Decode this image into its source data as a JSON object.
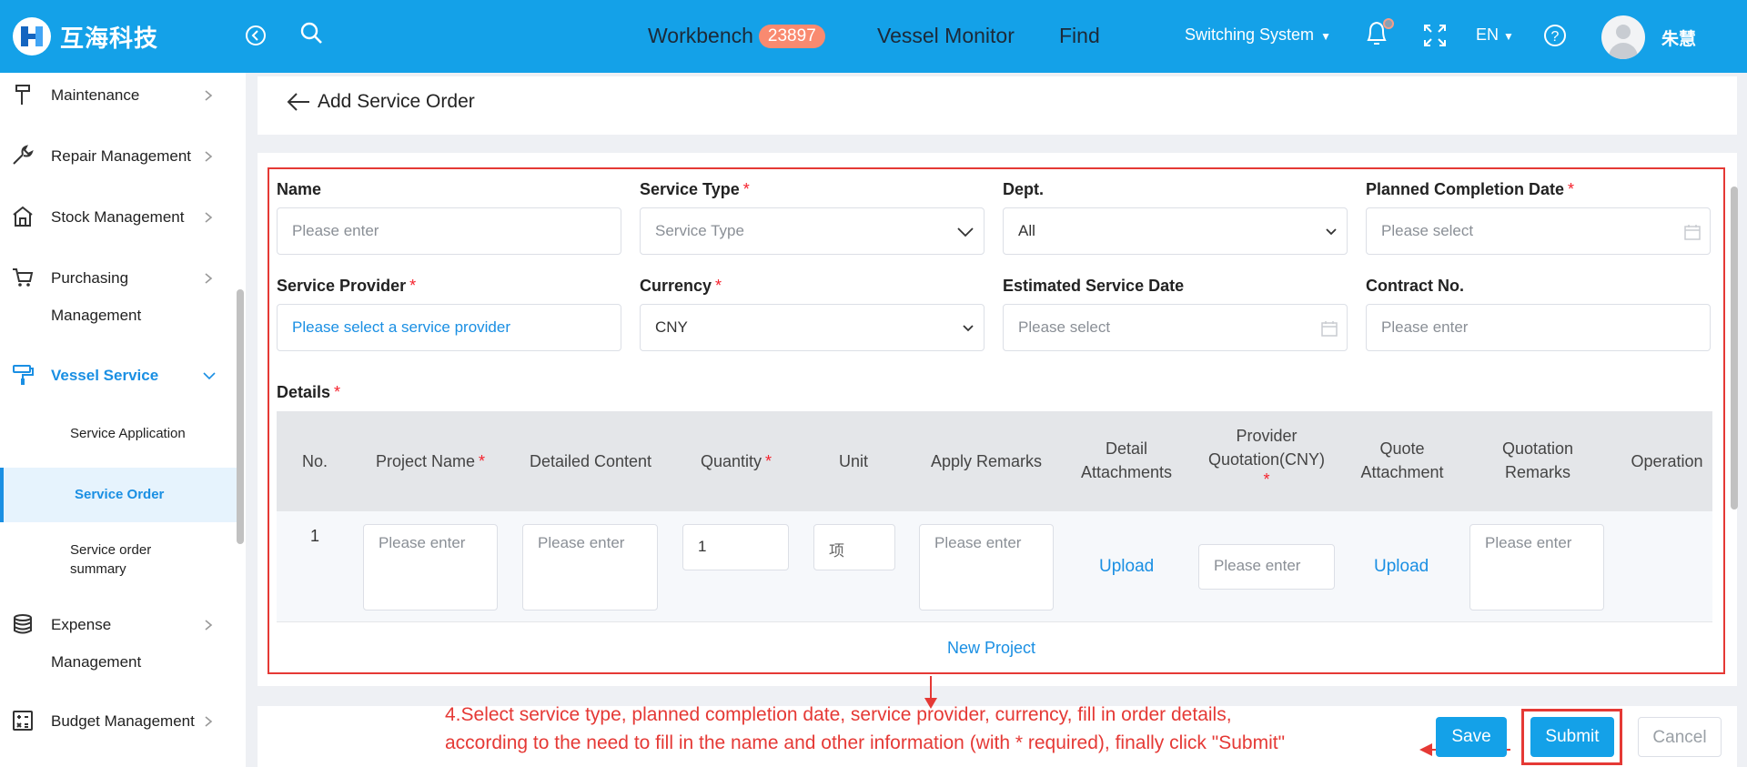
{
  "header": {
    "logo_text": "互海科技",
    "nav": [
      {
        "label": "Workbench",
        "badge": "23897"
      },
      {
        "label": "Vessel Monitor"
      },
      {
        "label": "Find"
      }
    ],
    "switching_system": "Switching System",
    "language": "EN",
    "user_name": "朱慧"
  },
  "sidebar": {
    "items": [
      {
        "label": "Maintenance",
        "icon": "hammer-icon"
      },
      {
        "label": "Repair Management",
        "icon": "wrench-icon"
      },
      {
        "label": "Stock Management",
        "icon": "warehouse-icon"
      },
      {
        "label_line1": "Purchasing",
        "label_line2": "Management",
        "icon": "cart-icon"
      },
      {
        "label": "Vessel Service",
        "icon": "paint-roller-icon",
        "active": true
      },
      {
        "label_line1": "Expense",
        "label_line2": "Management",
        "icon": "coins-icon"
      },
      {
        "label": "Budget Management",
        "icon": "calculator-icon"
      }
    ],
    "sub_items": [
      {
        "label": "Service Application"
      },
      {
        "label": "Service Order",
        "selected": true
      },
      {
        "label_line1": "Service order",
        "label_line2": "summary"
      }
    ]
  },
  "page": {
    "title": "Add Service Order"
  },
  "form": {
    "name": {
      "label": "Name",
      "placeholder": "Please enter"
    },
    "service_type": {
      "label": "Service Type",
      "required": "*",
      "placeholder": "Service Type"
    },
    "dept": {
      "label": "Dept.",
      "value": "All"
    },
    "planned_completion_date": {
      "label": "Planned Completion Date",
      "required": "*",
      "placeholder": "Please select"
    },
    "service_provider": {
      "label": "Service Provider",
      "required": "*",
      "value": "Please select a service provider"
    },
    "currency": {
      "label": "Currency",
      "required": "*",
      "value": "CNY"
    },
    "estimated_service_date": {
      "label": "Estimated Service Date",
      "placeholder": "Please select"
    },
    "contract_no": {
      "label": "Contract No.",
      "placeholder": "Please enter"
    },
    "details_label": "Details",
    "details_required": "*"
  },
  "details_table": {
    "headers": {
      "no": "No.",
      "project_name": "Project Name",
      "detailed_content": "Detailed Content",
      "quantity": "Quantity",
      "unit": "Unit",
      "apply_remarks": "Apply Remarks",
      "detail_attachments_1": "Detail",
      "detail_attachments_2": "Attachments",
      "provider_quotation_1": "Provider",
      "provider_quotation_2": "Quotation(CNY)",
      "quote_attachment_1": "Quote",
      "quote_attachment_2": "Attachment",
      "quotation_remarks_1": "Quotation",
      "quotation_remarks_2": "Remarks",
      "operation": "Operation",
      "required": "*"
    },
    "rows": [
      {
        "no": "1",
        "project_name_placeholder": "Please enter",
        "detailed_content_placeholder": "Please enter",
        "quantity": "1",
        "unit": "项",
        "apply_remarks_placeholder": "Please enter",
        "detail_attachments": "Upload",
        "provider_quotation_placeholder": "Please enter",
        "quote_attachment": "Upload",
        "quotation_remarks_placeholder": "Please enter"
      }
    ],
    "new_project": "New Project"
  },
  "annotation": {
    "line1": "4.Select service type, planned completion date, service provider, currency, fill in order details,",
    "line2": "according to the need to fill in the name and other information (with * required), finally click \"Submit\""
  },
  "actions": {
    "save": "Save",
    "submit": "Submit",
    "cancel": "Cancel"
  },
  "colors": {
    "header_bg": "#14a1e8",
    "accent": "#1a8fe3",
    "required": "#f5222d",
    "annotation": "#e53935",
    "badge": "#f98a70"
  }
}
